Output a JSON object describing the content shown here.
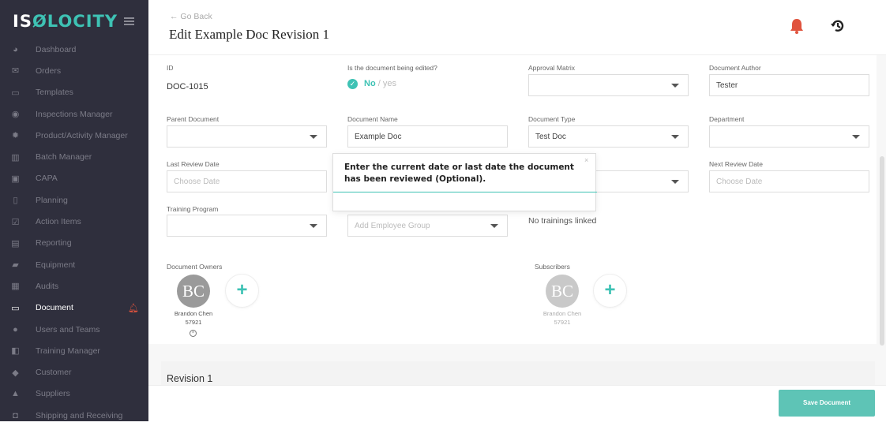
{
  "app": {
    "logo_left": "IS",
    "logo_accent": "ØLOCITY"
  },
  "sidebar": {
    "items": [
      {
        "label": "Dashboard",
        "icon": "dashboard-icon"
      },
      {
        "label": "Orders",
        "icon": "envelope-icon"
      },
      {
        "label": "Templates",
        "icon": "image-icon"
      },
      {
        "label": "Inspections Manager",
        "icon": "record-icon"
      },
      {
        "label": "Product/Activity Manager",
        "icon": "gear-icon"
      },
      {
        "label": "Batch Manager",
        "icon": "barcode-icon"
      },
      {
        "label": "CAPA",
        "icon": "briefcase-icon"
      },
      {
        "label": "Planning",
        "icon": "map-icon"
      },
      {
        "label": "Action Items",
        "icon": "checkbox-icon"
      },
      {
        "label": "Reporting",
        "icon": "chart-icon"
      },
      {
        "label": "Equipment",
        "icon": "truck-icon"
      },
      {
        "label": "Audits",
        "icon": "file-icon"
      },
      {
        "label": "Document",
        "icon": "folder-icon",
        "active": true
      },
      {
        "label": "Users and Teams",
        "icon": "users-icon"
      },
      {
        "label": "Training Manager",
        "icon": "book-icon"
      },
      {
        "label": "Customer",
        "icon": "tag-icon"
      },
      {
        "label": "Suppliers",
        "icon": "building-icon"
      },
      {
        "label": "Shipping and Receiving",
        "icon": "box-icon"
      }
    ]
  },
  "header": {
    "go_back": "Go Back",
    "title": "Edit Example Doc Revision 1"
  },
  "form": {
    "id_label": "ID",
    "id_value": "DOC-1015",
    "editing_label": "Is the document being edited?",
    "editing_no": "No",
    "editing_sep": " / ",
    "editing_yes": "yes",
    "approval_label": "Approval Matrix",
    "author_label": "Document Author",
    "author_value": "Tester",
    "parent_label": "Parent Document",
    "name_label": "Document Name",
    "name_value": "Example Doc",
    "type_label": "Document Type",
    "type_value": "Test Doc",
    "department_label": "Department",
    "last_review_label": "Last Review Date",
    "last_review_placeholder": "Choose Date",
    "next_review_label": "Next Review Date",
    "next_review_placeholder": "Choose Date",
    "training_label": "Training Program",
    "employee_group_placeholder": "Add Employee Group",
    "no_trainings": "No trainings linked",
    "owners_label": "Document Owners",
    "subscribers_label": "Subscribers",
    "owner": {
      "initials": "BC",
      "name": "Brandon Chen",
      "number": "57921"
    },
    "subscriber": {
      "initials": "BC",
      "name": "Brandon Chen",
      "number": "57921"
    }
  },
  "tooltip": {
    "text": "Enter the current date or last date the document has been reviewed (Optional).",
    "close": "×"
  },
  "revision_title": "Revision 1",
  "save_label": "Save Document",
  "colors": {
    "accent": "#3ec2b4",
    "sidebar": "#2f2f3d",
    "alert": "#e0533e"
  }
}
